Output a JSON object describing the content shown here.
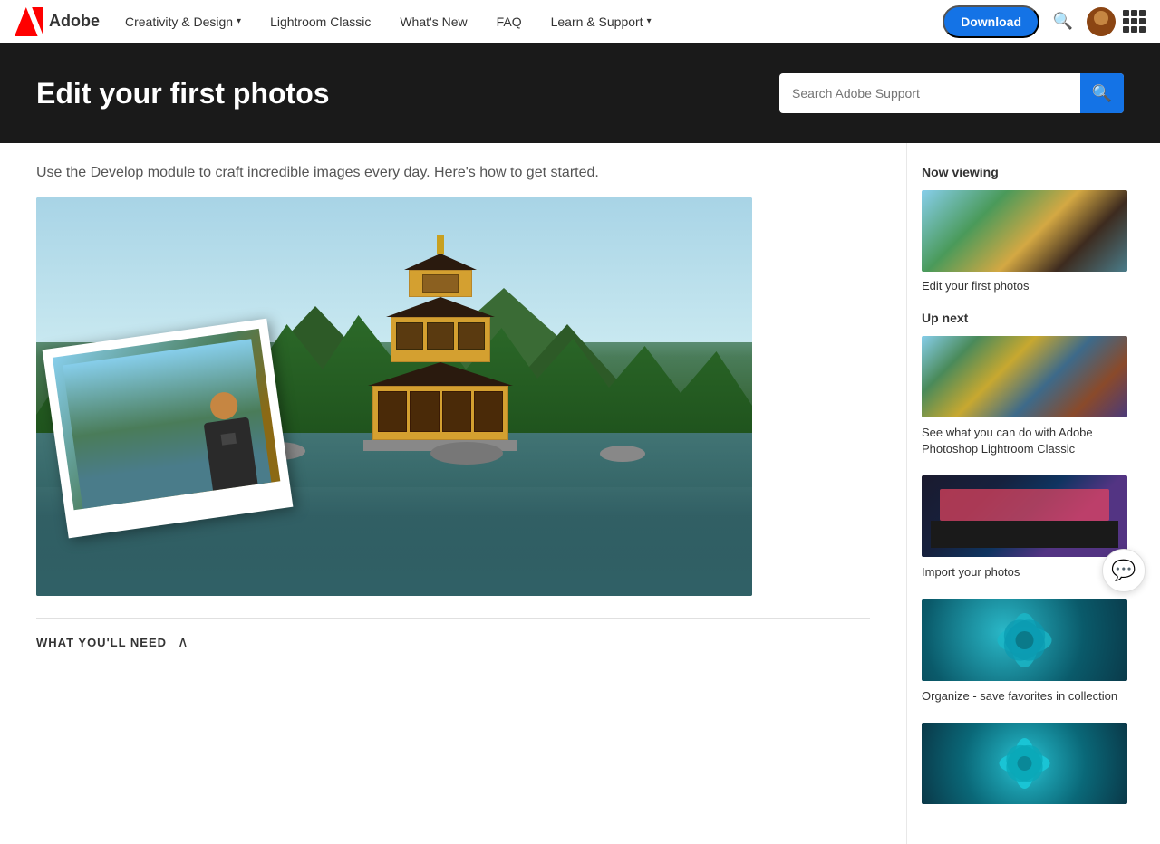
{
  "nav": {
    "logo_text": "Adobe",
    "items": [
      {
        "label": "Creativity & Design",
        "has_chevron": true
      },
      {
        "label": "Lightroom Classic",
        "has_chevron": false
      },
      {
        "label": "What's New",
        "has_chevron": false
      },
      {
        "label": "FAQ",
        "has_chevron": false
      },
      {
        "label": "Learn & Support",
        "has_chevron": true
      }
    ],
    "download_label": "Download"
  },
  "hero": {
    "title": "Edit your first photos",
    "search_placeholder": "Search Adobe Support"
  },
  "content": {
    "intro": "Use the Develop module to craft incredible images every day. Here's how to get started.",
    "what_youll_need": "WHAT YOU'LL NEED"
  },
  "sidebar": {
    "now_viewing_label": "Now viewing",
    "now_viewing_item": "Edit your first photos",
    "up_next_label": "Up next",
    "cards": [
      {
        "label": "See what you can do with Adobe Photoshop Lightroom Classic"
      },
      {
        "label": "Import your photos"
      },
      {
        "label": "Organize - save favorites in collection"
      },
      {
        "label": ""
      }
    ]
  },
  "chat": {
    "icon": "💬"
  }
}
